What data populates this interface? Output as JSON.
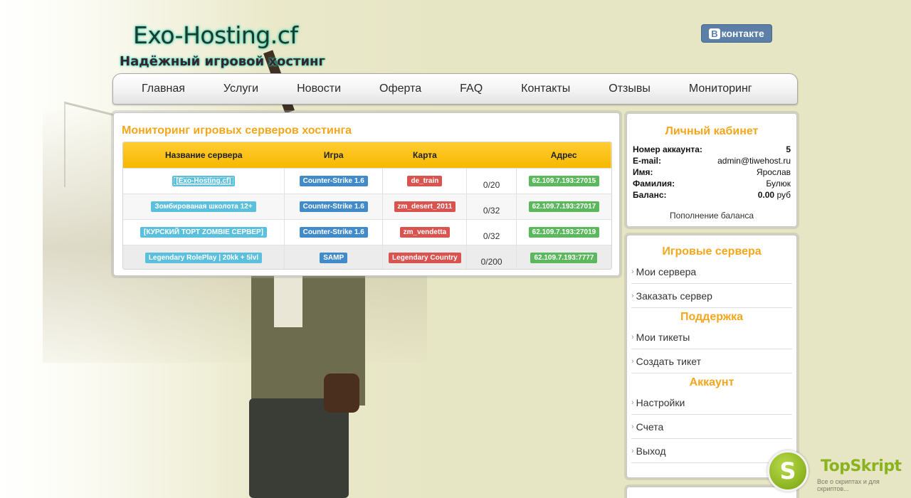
{
  "header": {
    "logo": "Exo-Hosting.cf",
    "tagline": "Надёжный игровой хостинг",
    "vk_b": "B",
    "vk_label": "контакте"
  },
  "nav": {
    "items": [
      "Главная",
      "Услуги",
      "Новости",
      "Оферта",
      "FAQ",
      "Контакты",
      "Отзывы",
      "Мониторинг"
    ]
  },
  "monitoring": {
    "title": "Мониторинг игровых серверов хостинга",
    "columns": [
      "Название сервера",
      "Игра",
      "Карта",
      "",
      "Адрес"
    ],
    "rows": [
      {
        "name": "[Exo-Hosting.cf]",
        "game": "Counter-Strike 1.6",
        "map": "de_train",
        "players": "0/20",
        "address": "62.109.7.193:27015"
      },
      {
        "name": "Зомбированая школота 12+",
        "game": "Counter-Strike 1.6",
        "map": "zm_desert_2011",
        "players": "0/32",
        "address": "62.109.7.193:27017"
      },
      {
        "name": "[КУРСКИЙ ТОРТ ZOMBIE СЕРВЕР]",
        "game": "Counter-Strike 1.6",
        "map": "zm_vendetta",
        "players": "0/32",
        "address": "62.109.7.193:27019"
      },
      {
        "name": "Legendary RolePlay | 20kk + 5lvl",
        "game": "SAMP",
        "map": "Legendary Country",
        "players": "0/200",
        "address": "62.109.7.193:7777"
      }
    ]
  },
  "account": {
    "title": "Личный кабинет",
    "rows": [
      {
        "key": "Номер аккаунта:",
        "value": "5"
      },
      {
        "key": "E-mail:",
        "value": "admin@tiwehost.ru"
      },
      {
        "key": "Имя:",
        "value": "Ярослав"
      },
      {
        "key": "Фамилия:",
        "value": "Булюк"
      }
    ],
    "balance_key": "Баланс:",
    "balance_value": "0.00",
    "balance_currency": "руб",
    "topup": "Пополнение баланса"
  },
  "sidebar": {
    "servers_title": "Игровые сервера",
    "servers_items": [
      "Мои сервера",
      "Заказать сервер"
    ],
    "support_title": "Поддержка",
    "support_items": [
      "Мои тикеты",
      "Создать тикет"
    ],
    "account_title": "Аккаунт",
    "account_items": [
      "Настройки",
      "Счета",
      "Выход"
    ]
  },
  "watermark": {
    "letter": "S",
    "name": "TopSkript",
    "sub": "Все о скриптах и для скриптов..."
  }
}
